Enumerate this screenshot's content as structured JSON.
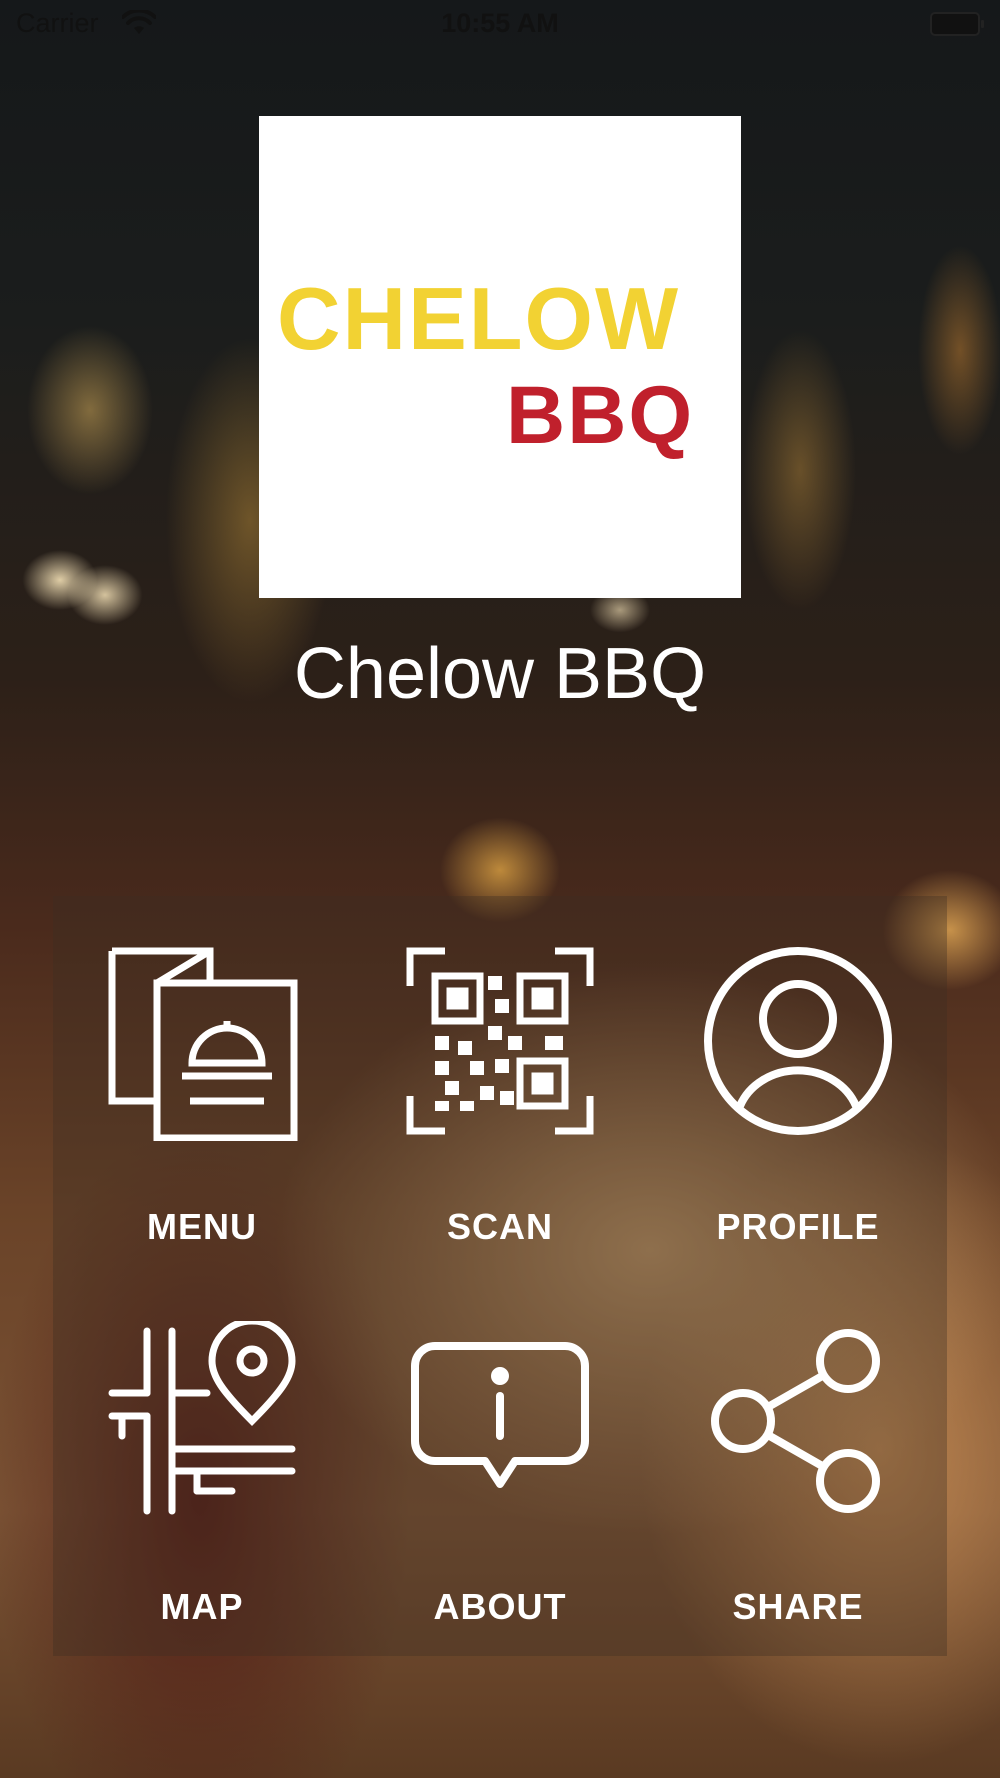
{
  "status_bar": {
    "carrier": "Carrier",
    "time": "10:55 AM"
  },
  "brand": {
    "logo_line1": "CHELOW",
    "logo_line2": "BBQ",
    "logo_colors": {
      "line1": "#f2d233",
      "line2": "#c0202c"
    },
    "title": "Chelow BBQ"
  },
  "menu": {
    "items": [
      {
        "label": "MENU",
        "icon": "menu-icon"
      },
      {
        "label": "SCAN",
        "icon": "qr-code-icon"
      },
      {
        "label": "PROFILE",
        "icon": "profile-icon"
      },
      {
        "label": "MAP",
        "icon": "map-pin-icon"
      },
      {
        "label": "ABOUT",
        "icon": "info-icon"
      },
      {
        "label": "SHARE",
        "icon": "share-icon"
      }
    ]
  }
}
